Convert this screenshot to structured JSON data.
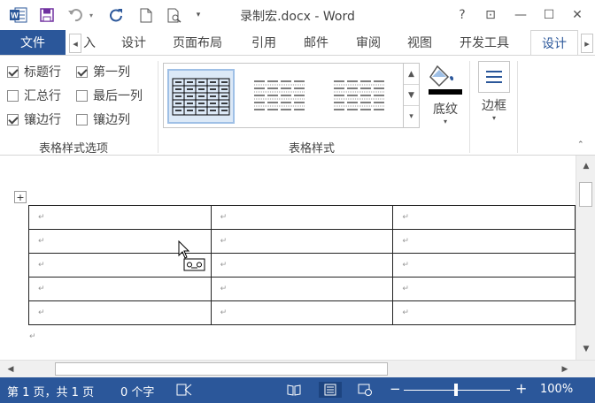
{
  "window": {
    "title": "录制宏.docx - Word",
    "help": "?",
    "ribbon_display": "⊡",
    "minimize": "—",
    "maximize": "☐",
    "close": "✕"
  },
  "qat": {
    "app_icon_letter": "W",
    "customize": "▾"
  },
  "tabs": {
    "file": "文件",
    "scroll_left": "◂",
    "partial": "入",
    "design": "设计",
    "layout": "页面布局",
    "references": "引用",
    "mailings": "邮件",
    "review": "审阅",
    "view": "视图",
    "developer": "开发工具",
    "table_design": "设计",
    "scroll_right": "▸"
  },
  "ribbon": {
    "style_options": {
      "header_row": "标题行",
      "first_column": "第一列",
      "total_row": "汇总行",
      "last_column": "最后一列",
      "banded_rows": "镶边行",
      "banded_columns": "镶边列",
      "group_label": "表格样式选项"
    },
    "table_styles": {
      "group_label": "表格样式",
      "shading_label": "底纹",
      "shading_color": "#000000"
    },
    "borders": {
      "label": "边框"
    },
    "dropdown_glyph": "▾",
    "gallery_up": "▲",
    "gallery_down": "▼",
    "gallery_more": "▾"
  },
  "document": {
    "table_handle": "+",
    "cell_mark": "↵",
    "paragraph_mark": "↵",
    "rows": [
      [
        "↵",
        "↵",
        "↵"
      ],
      [
        "↵",
        "↵",
        "↵"
      ],
      [
        "↵",
        "↵",
        "↵"
      ],
      [
        "↵",
        "↵",
        "↵"
      ],
      [
        "↵",
        "↵",
        "↵"
      ]
    ]
  },
  "scrollbars": {
    "up": "▲",
    "down": "▼",
    "left": "◀",
    "right": "▶"
  },
  "statusbar": {
    "page": "第 1 页，共 1 页",
    "words": "0 个字",
    "zoom_minus": "−",
    "zoom_plus": "+",
    "zoom": "100%"
  },
  "colors": {
    "accent": "#2b579a",
    "status_bar": "#2b579a"
  }
}
